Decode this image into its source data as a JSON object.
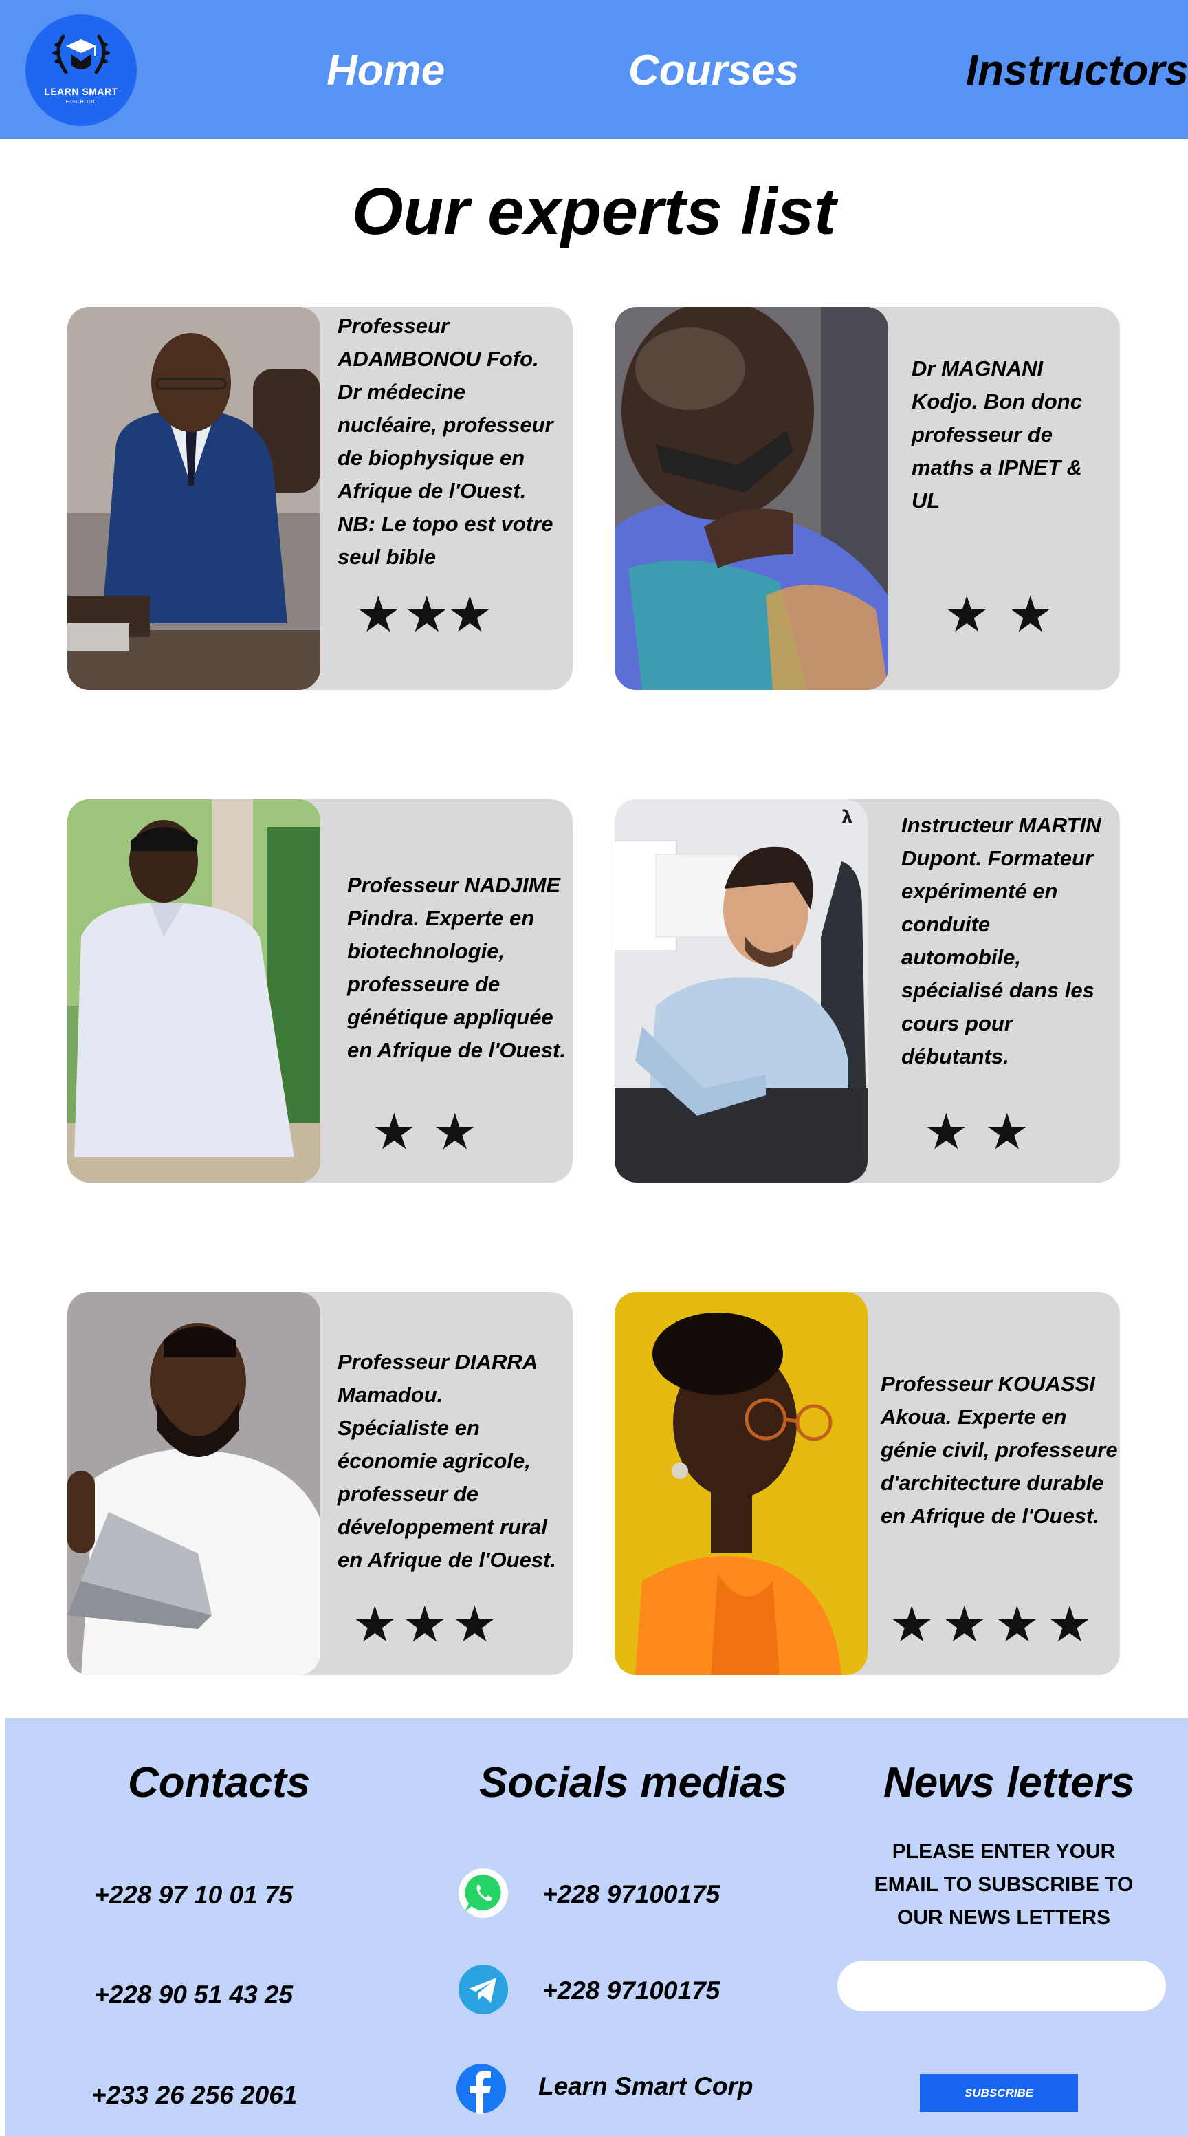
{
  "nav": {
    "logo_line1": "LEARN SMART",
    "logo_line2": "E-SCHOOL",
    "items": [
      {
        "label": "Home"
      },
      {
        "label": "Courses"
      },
      {
        "label": "Instructors"
      }
    ],
    "colors": {
      "bar": "#5693f5",
      "logo": "#1f66f0",
      "active": "#000000",
      "inactive": "#ffffff"
    }
  },
  "page_title": "Our experts list",
  "experts": [
    {
      "text": "Professeur ADAMBONOU Fofo. Dr médecine nucléaire, professeur de biophysique en Afrique de l'Ouest. NB: Le topo est votre seul bible",
      "rating": 3
    },
    {
      "text": "Dr MAGNANI Kodjo. Bon donc professeur de maths a IPNET & UL",
      "rating": 2
    },
    {
      "text": "Professeur NADJIME Pindra. Experte en biotechnologie, professeure de génétique appliquée en Afrique de l'Ouest.",
      "rating": 2
    },
    {
      "text": "Instructeur MARTIN Dupont. Formateur expérimenté en conduite automobile, spécialisé dans les cours pour débutants.",
      "rating": 2
    },
    {
      "text": "Professeur DIARRA Mamadou. Spécialiste en économie agricole, professeur de développement rural en Afrique de l'Ouest.",
      "rating": 3
    },
    {
      "text": "Professeur KOUASSI Akoua. Experte en génie civil, professeure d'architecture durable en Afrique de l'Ouest.",
      "rating": 4
    }
  ],
  "footer": {
    "contacts": {
      "heading": "Contacts",
      "phones": [
        "+228 97 10 01 75",
        "+228 90 51 43 25",
        "+233 26 256 2061"
      ]
    },
    "socials": {
      "heading": "Socials medias",
      "items": [
        {
          "icon": "whatsapp-icon",
          "label": "+228 97100175",
          "color": "#25d366"
        },
        {
          "icon": "telegram-icon",
          "label": "+228 97100175",
          "color": "#2aa3e0"
        },
        {
          "icon": "facebook-icon",
          "label": "Learn Smart Corp",
          "color": "#1877f2"
        }
      ]
    },
    "newsletter": {
      "heading": "News letters",
      "text": "PLEASE ENTER YOUR EMAIL TO SUBSCRIBE TO OUR NEWS LETTERS",
      "email_placeholder": "",
      "button_label": "SUBSCRIBE"
    },
    "background": "#c2d4fa"
  }
}
